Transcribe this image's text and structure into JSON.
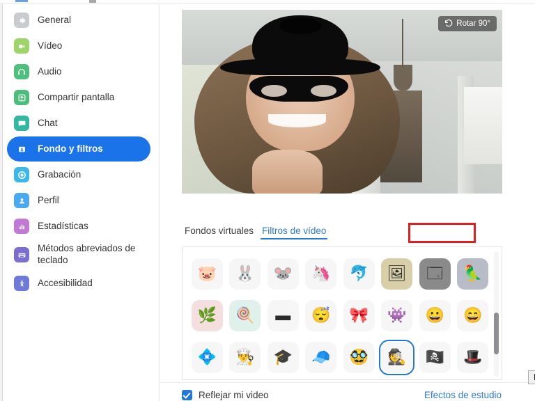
{
  "window": {
    "app": "Zoom Settings"
  },
  "sidebar": {
    "items": [
      {
        "label": "General",
        "icon": "gear-icon",
        "color": "#c9cccf",
        "active": false
      },
      {
        "label": "Vídeo",
        "icon": "video-camera-icon",
        "color": "#9ed46a",
        "active": false
      },
      {
        "label": "Audio",
        "icon": "headphones-icon",
        "color": "#4fbf7e",
        "active": false
      },
      {
        "label": "Compartir pantalla",
        "icon": "share-screen-icon",
        "color": "#4cbd7a",
        "active": false
      },
      {
        "label": "Chat",
        "icon": "chat-bubble-icon",
        "color": "#32b8a0",
        "active": false
      },
      {
        "label": "Fondo y filtros",
        "icon": "background-filters-icon",
        "color": "#1a73e8",
        "active": true
      },
      {
        "label": "Grabación",
        "icon": "record-circle-icon",
        "color": "#3bb8e8",
        "active": false
      },
      {
        "label": "Perfil",
        "icon": "profile-person-icon",
        "color": "#4aa9f0",
        "active": false
      },
      {
        "label": "Estadísticas",
        "icon": "statistics-bar-icon",
        "color": "#c07ad6",
        "active": false
      },
      {
        "label": "Métodos abreviados de teclado",
        "icon": "keyboard-icon",
        "color": "#7a6fd0",
        "active": false
      },
      {
        "label": "Accesibilidad",
        "icon": "accessibility-icon",
        "color": "#6f7ad8",
        "active": false
      }
    ]
  },
  "preview": {
    "rotate_label": "Rotar 90°",
    "rotate_icon": "rotate-ccw-icon"
  },
  "tabs": [
    {
      "label": "Fondos virtuales",
      "active": false
    },
    {
      "label": "Filtros de vídeo",
      "active": true
    }
  ],
  "filters": {
    "selected_index": 21,
    "tooltip": "Bandit",
    "items": [
      {
        "name": "pig-face-filter",
        "glyph": "🐷",
        "bg": "#f6f6f6"
      },
      {
        "name": "rabbit-ears-filter",
        "glyph": "🐰",
        "bg": "#f6f6f6"
      },
      {
        "name": "mouse-ears-filter",
        "glyph": "🐭",
        "bg": "#f6f6f6"
      },
      {
        "name": "unicorn-horn-filter",
        "glyph": "🦄",
        "bg": "#f6f6f6"
      },
      {
        "name": "narwhal-filter",
        "glyph": "🐬",
        "bg": "#f6f6f6"
      },
      {
        "name": "gold-frame-filter",
        "glyph": "🖼",
        "bg": "#d8cfa8"
      },
      {
        "name": "dark-frame-filter",
        "glyph": "🗔",
        "bg": "#8a8a8a"
      },
      {
        "name": "cockatiel-bird-filter",
        "glyph": "🦜",
        "bg": "#b7bcc7"
      },
      {
        "name": "leaf-corner-filter",
        "glyph": "🌿",
        "bg": "#f4dede"
      },
      {
        "name": "lollipop-filter",
        "glyph": "🍭",
        "bg": "#dff1ea"
      },
      {
        "name": "unibrow-filter",
        "glyph": "▬",
        "bg": "#f6f6f6"
      },
      {
        "name": "sleepy-zzz-filter",
        "glyph": "😴",
        "bg": "#f6f6f6"
      },
      {
        "name": "red-bandana-filter",
        "glyph": "🎀",
        "bg": "#f6f6f6"
      },
      {
        "name": "antenna-bug-filter",
        "glyph": "👾",
        "bg": "#f6f6f6"
      },
      {
        "name": "blonde-bangs-filter",
        "glyph": "😀",
        "bg": "#f6f6f6"
      },
      {
        "name": "long-hair-filter",
        "glyph": "😄",
        "bg": "#f6f6f6"
      },
      {
        "name": "blue-flowers-filter",
        "glyph": "💠",
        "bg": "#f6f6f6"
      },
      {
        "name": "chef-hat-filter",
        "glyph": "👨‍🍳",
        "bg": "#f6f6f6"
      },
      {
        "name": "graduation-cap-filter",
        "glyph": "🎓",
        "bg": "#f6f6f6"
      },
      {
        "name": "red-beret-filter",
        "glyph": "🧢",
        "bg": "#f6f6f6"
      },
      {
        "name": "mustache-filter",
        "glyph": "🥸",
        "bg": "#f6f6f6"
      },
      {
        "name": "bandit-hat-mask-filter",
        "glyph": "🕵",
        "bg": "#f6f6f6"
      },
      {
        "name": "pirate-hat-filter",
        "glyph": "🏴‍☠️",
        "bg": "#f6f6f6"
      },
      {
        "name": "black-fedora-filter",
        "glyph": "🎩",
        "bg": "#f6f6f6"
      }
    ]
  },
  "bottom": {
    "mirror_label": "Reflejar mi video",
    "mirror_checked": true,
    "studio_effects_label": "Efectos de estudio"
  }
}
